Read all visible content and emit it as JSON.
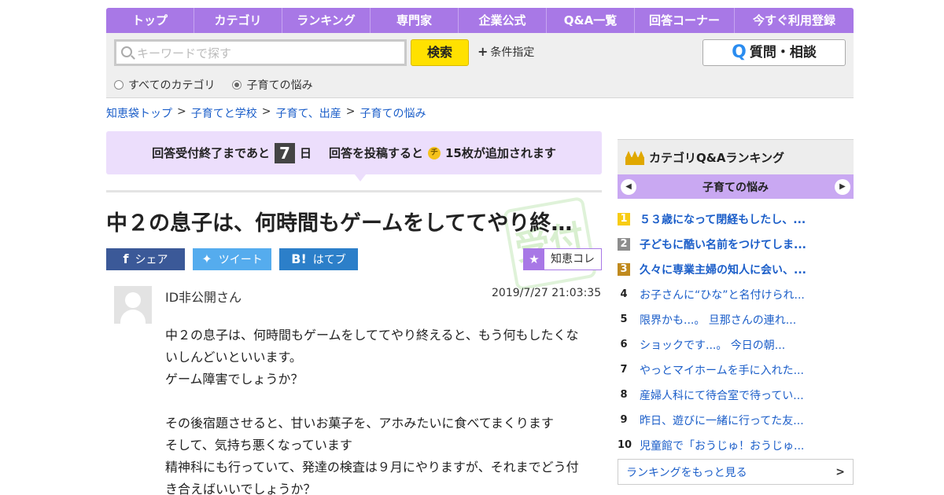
{
  "nav": {
    "items": [
      "トップ",
      "カテゴリ",
      "ランキング",
      "専門家",
      "企業公式",
      "Q&A一覧",
      "回答コーナー",
      "今すぐ利用登録"
    ]
  },
  "search": {
    "placeholder": "キーワードで探す",
    "button": "検索",
    "conditions": "条件指定",
    "ask_button": "質問・相談",
    "radio_all": "すべてのカテゴリ",
    "radio_current": "子育ての悩み"
  },
  "breadcrumb": [
    "知恵袋トップ",
    "子育てと学校",
    "子育て、出産",
    "子育ての悩み"
  ],
  "notice": {
    "before": "回答受付終了まであと",
    "days": "7",
    "day_unit": "日",
    "middle": "回答を投稿すると",
    "coin_char": "チ",
    "after": "15枚が追加されます"
  },
  "question": {
    "title": "中２の息子は、何時間もゲームをしててやり終…",
    "author": "ID非公開さん",
    "datetime": "2019/7/27  21:03:35",
    "body": [
      "中２の息子は、何時間もゲームをしててやり終えると、もう何もしたくな",
      "いしんどいといいます。",
      "ゲーム障害でしょうか？",
      "",
      "その後宿題させると、甘いお菓子を、アホみたいに食べてまくります",
      "そして、気持ち悪くなっています",
      "精神科にも行っていて、発達の検査は９月にやりますが、それまでどう付",
      "き合えばいいでしょうか？"
    ]
  },
  "share": {
    "facebook": "シェア",
    "twitter": "ツイート",
    "hatena": "はてブ",
    "chiekore": "知恵コレ"
  },
  "sidebar": {
    "title": "カテゴリQ&Aランキング",
    "category": "子育ての悩み",
    "ranking": [
      {
        "num": "1",
        "text": "５３歳になって閉経もしたし、..."
      },
      {
        "num": "2",
        "text": "子どもに酷い名前をつけてしま..."
      },
      {
        "num": "3",
        "text": "久々に専業主婦の知人に会い、..."
      },
      {
        "num": "4",
        "text": "お子さんに“ひな”と名付けられ..."
      },
      {
        "num": "5",
        "text": "限界かも...。 旦那さんの連れ..."
      },
      {
        "num": "6",
        "text": "ショックです...。 今日の朝..."
      },
      {
        "num": "7",
        "text": "やっとマイホームを手に入れた..."
      },
      {
        "num": "8",
        "text": "産婦人科にて待合室で待ってい..."
      },
      {
        "num": "9",
        "text": "昨日、遊びに一緒に行ってた友..."
      },
      {
        "num": "10",
        "text": "児童館で「おうじゅ！おうじゅ..."
      }
    ],
    "more": "ランキングをもっと見る"
  },
  "colors": {
    "accent": "#a878e6",
    "notice_bg": "#ecdefc",
    "search_button": "#ffe100",
    "link": "#1b5ec9"
  }
}
